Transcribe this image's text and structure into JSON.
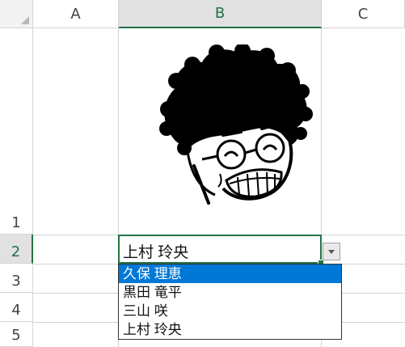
{
  "columns": [
    {
      "label": "A",
      "selected": false
    },
    {
      "label": "B",
      "selected": true
    },
    {
      "label": "C",
      "selected": false
    }
  ],
  "rows": [
    {
      "label": "1",
      "selected": false
    },
    {
      "label": "2",
      "selected": true
    },
    {
      "label": "3",
      "selected": false
    },
    {
      "label": "4",
      "selected": false
    },
    {
      "label": "5",
      "selected": false
    }
  ],
  "active_cell": {
    "value": "上村 玲央"
  },
  "dropdown": {
    "options": [
      "久保 理恵",
      "黒田 竜平",
      "三山 咲",
      "上村 玲央"
    ],
    "highlighted_index": 0
  },
  "colors": {
    "selection_green": "#217346",
    "highlight_blue": "#0078d7",
    "gridline": "#d4d4d4"
  },
  "icons": {
    "avatar": "curly-hair-smiling-face-with-glasses-illustration",
    "dropdown_button": "chevron-down-icon"
  }
}
